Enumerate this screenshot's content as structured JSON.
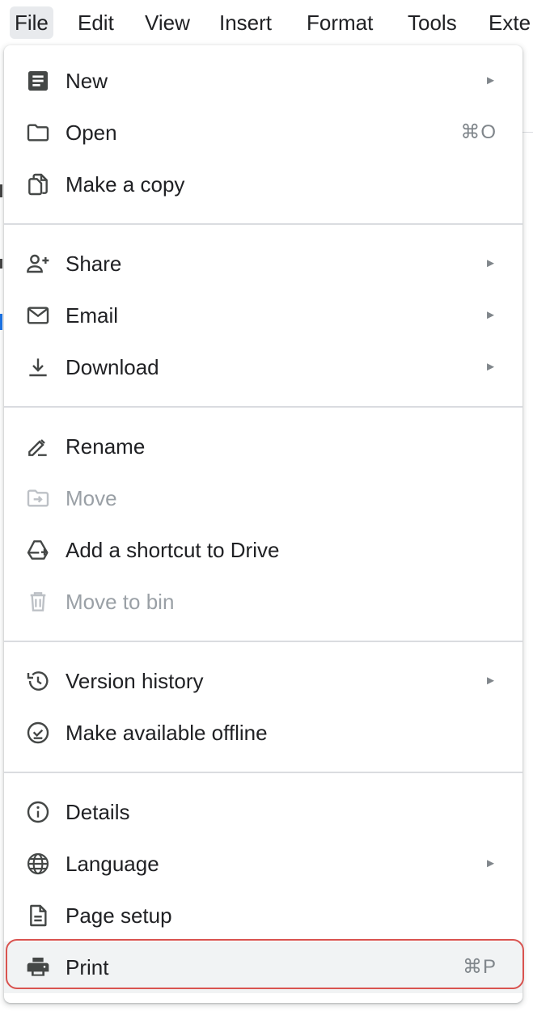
{
  "menubar": {
    "items": [
      {
        "label": "File",
        "active": true
      },
      {
        "label": "Edit"
      },
      {
        "label": "View"
      },
      {
        "label": "Insert"
      },
      {
        "label": "Format"
      },
      {
        "label": "Tools"
      },
      {
        "label": "Exte"
      }
    ]
  },
  "file_menu": {
    "items": [
      {
        "label": "New",
        "icon": "document-icon",
        "submenu": true
      },
      {
        "label": "Open",
        "icon": "folder-icon",
        "shortcut": "⌘O"
      },
      {
        "label": "Make a copy",
        "icon": "copy-icon"
      },
      {
        "label": "Share",
        "icon": "person-add-icon",
        "submenu": true
      },
      {
        "label": "Email",
        "icon": "envelope-icon",
        "submenu": true
      },
      {
        "label": "Download",
        "icon": "download-icon",
        "submenu": true
      },
      {
        "label": "Rename",
        "icon": "rename-pen-icon"
      },
      {
        "label": "Move",
        "icon": "move-folder-icon",
        "disabled": true
      },
      {
        "label": "Add a shortcut to Drive",
        "icon": "drive-shortcut-icon"
      },
      {
        "label": "Move to bin",
        "icon": "trash-icon",
        "disabled": true
      },
      {
        "label": "Version history",
        "icon": "history-icon",
        "submenu": true
      },
      {
        "label": "Make available offline",
        "icon": "offline-check-icon"
      },
      {
        "label": "Details",
        "icon": "info-icon"
      },
      {
        "label": "Language",
        "icon": "globe-icon",
        "submenu": true
      },
      {
        "label": "Page setup",
        "icon": "page-setup-icon"
      },
      {
        "label": "Print",
        "icon": "printer-icon",
        "shortcut": "⌘P",
        "highlighted": true
      }
    ],
    "submenu_arrow": "►"
  },
  "colors": {
    "text": "#202124",
    "disabled_text": "#9aa0a6",
    "highlight_ring": "#d9534f",
    "hover_bg": "#f1f3f4"
  }
}
